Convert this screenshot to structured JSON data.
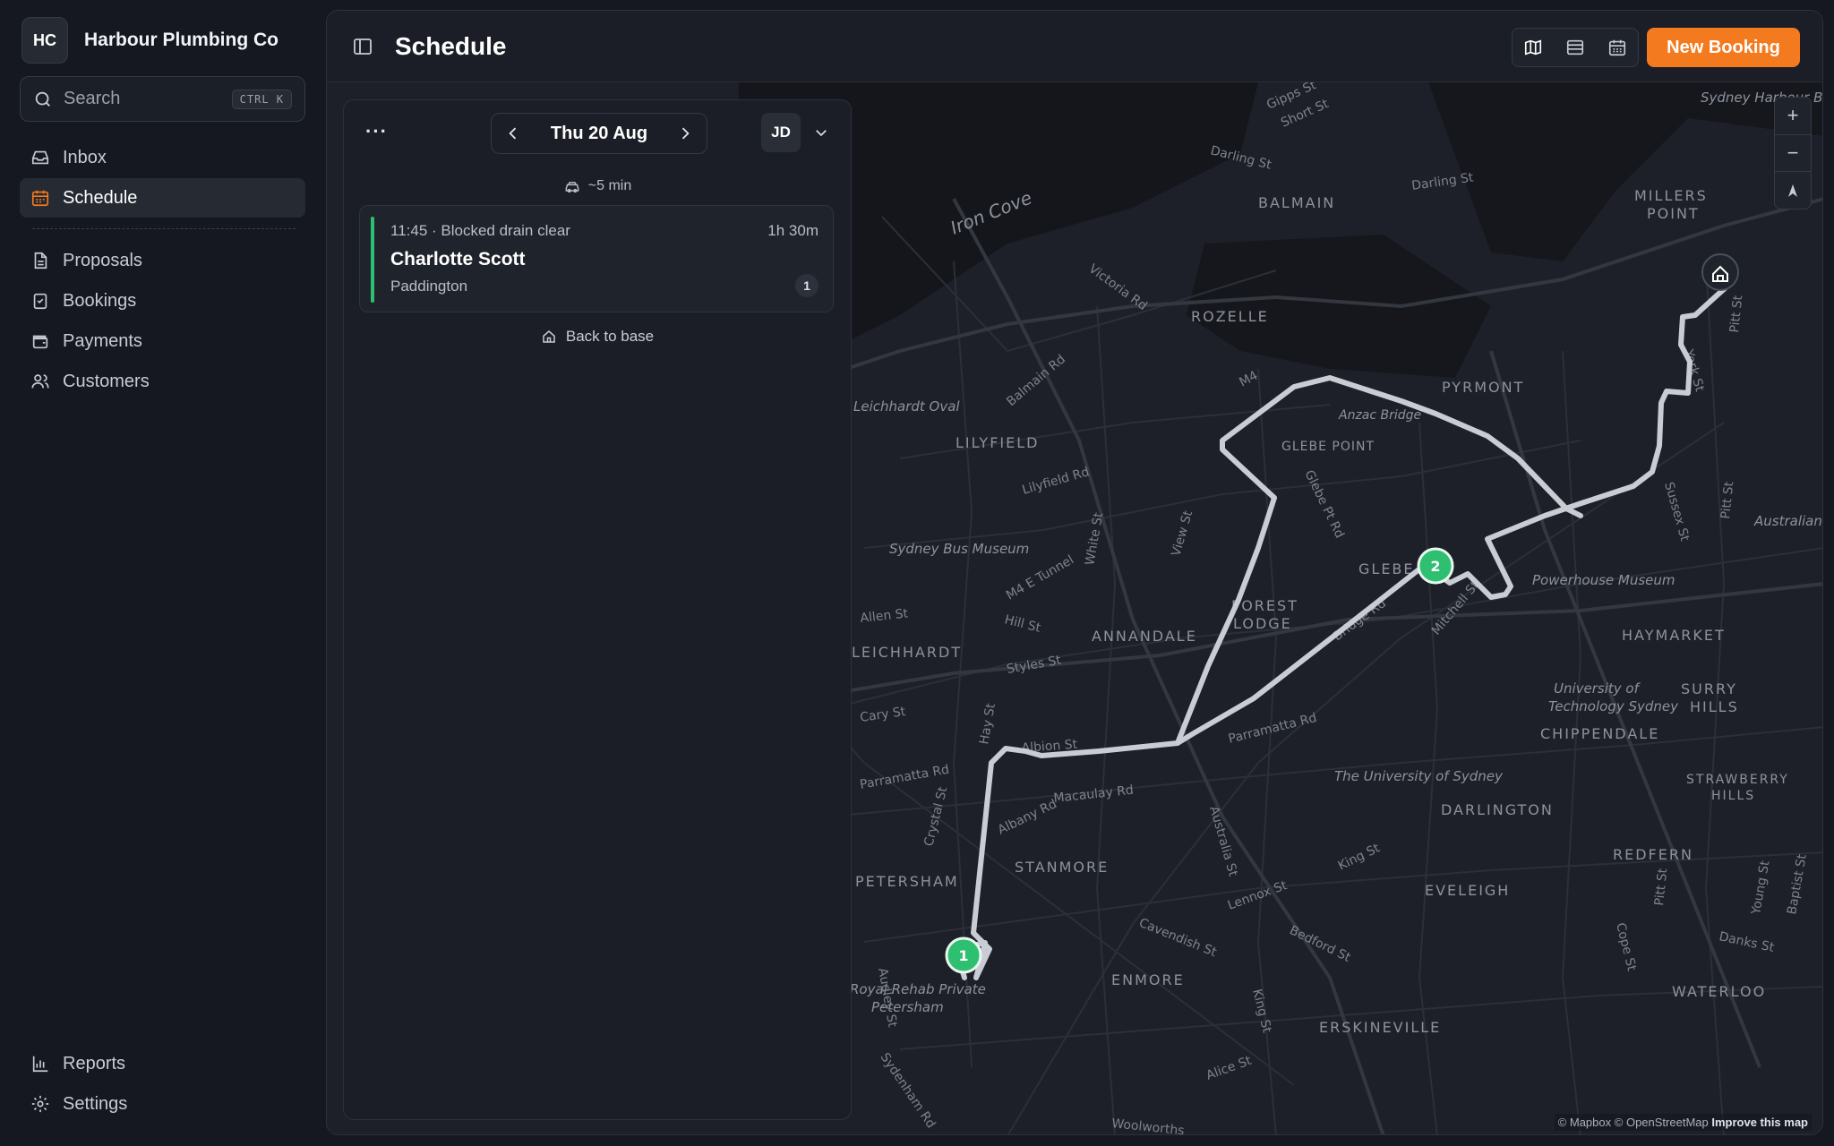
{
  "org": {
    "initials": "HC",
    "name": "Harbour Plumbing Co"
  },
  "search": {
    "placeholder": "Search",
    "shortcut": "CTRL K"
  },
  "nav": {
    "primary": [
      {
        "label": "Inbox",
        "icon": "inbox-icon"
      },
      {
        "label": "Schedule",
        "icon": "calendar-icon",
        "active": true
      }
    ],
    "secondary": [
      {
        "label": "Proposals",
        "icon": "document-icon"
      },
      {
        "label": "Bookings",
        "icon": "clipboard-check-icon"
      },
      {
        "label": "Payments",
        "icon": "wallet-icon"
      },
      {
        "label": "Customers",
        "icon": "users-icon"
      }
    ],
    "footer": [
      {
        "label": "Reports",
        "icon": "bar-chart-icon"
      },
      {
        "label": "Settings",
        "icon": "gear-icon"
      }
    ]
  },
  "header": {
    "title": "Schedule",
    "new_booking_label": "New Booking"
  },
  "day_panel": {
    "date": "Thu 20 Aug",
    "technician": "JD",
    "travel_time": "~5 min",
    "jobs": [
      {
        "time_service": "11:45 · Blocked drain clear",
        "duration": "1h 30m",
        "customer": "Charlotte Scott",
        "suburb": "Paddington",
        "number": "1"
      }
    ],
    "back_to_base": "Back to base"
  },
  "map": {
    "markers": [
      "1",
      "2"
    ],
    "labels": {
      "suburbs": [
        "BALMAIN",
        "ROZELLE",
        "PYRMONT",
        "GLEBE POINT",
        "LILYFIELD",
        "GLEBE",
        "FOREST",
        "LODGE",
        "ANNANDALE",
        "LEICHHARDT",
        "HAYMARKET",
        "SURRY",
        "HILLS",
        "CHIPPENDALE",
        "STRAWBERRY",
        "HILLS",
        "DARLINGTON",
        "PETERSHAM",
        "STANMORE",
        "REDFERN",
        "EVELEIGH",
        "ENMORE",
        "ERSKINEVILLE",
        "WATERLOO",
        "MILLERS",
        "POINT"
      ],
      "places": [
        "Iron Cove",
        "Sydney Bus Museum",
        "Powerhouse Museum",
        "University of",
        "Technology Sydney",
        "The University of Sydney",
        "Royal Rehab Private",
        "Petersham",
        "Leichhardt Oval",
        "Sydney Harbour Bridge",
        "Anzac Bridge",
        "Australian Museum"
      ],
      "streets": [
        "Darling St",
        "Darling St",
        "Victoria Rd",
        "Balmain Rd",
        "Lilyfield Rd",
        "M4 E Tunnel",
        "White St",
        "Hill St",
        "Styles St",
        "Allen St",
        "Cary St",
        "Hay St",
        "Albion St",
        "Parramatta Rd",
        "Parramatta Rd",
        "Macaulay Rd",
        "Albany Rd",
        "Crystal St",
        "Audley St",
        "Cavendish St",
        "Bedford St",
        "Lennox St",
        "King St",
        "King St",
        "Alice St",
        "Sydenham Rd",
        "Australia St",
        "Bridge Rd",
        "Mitchell St",
        "Glebe Pt Rd",
        "View St",
        "M4",
        "York St",
        "Pitt St",
        "Sussex St",
        "Pitt St",
        "Cope St",
        "Pitt St",
        "Young St",
        "Baptist St",
        "Danks St",
        "Woolworths",
        "Gipps St",
        "Short St"
      ]
    },
    "attribution": {
      "mapbox": "© Mapbox",
      "osm": "© OpenStreetMap",
      "improve": "Improve this map"
    }
  },
  "colors": {
    "accent": "#f37a1f",
    "marker": "#2fbf71",
    "route": "#c9ccd3"
  }
}
